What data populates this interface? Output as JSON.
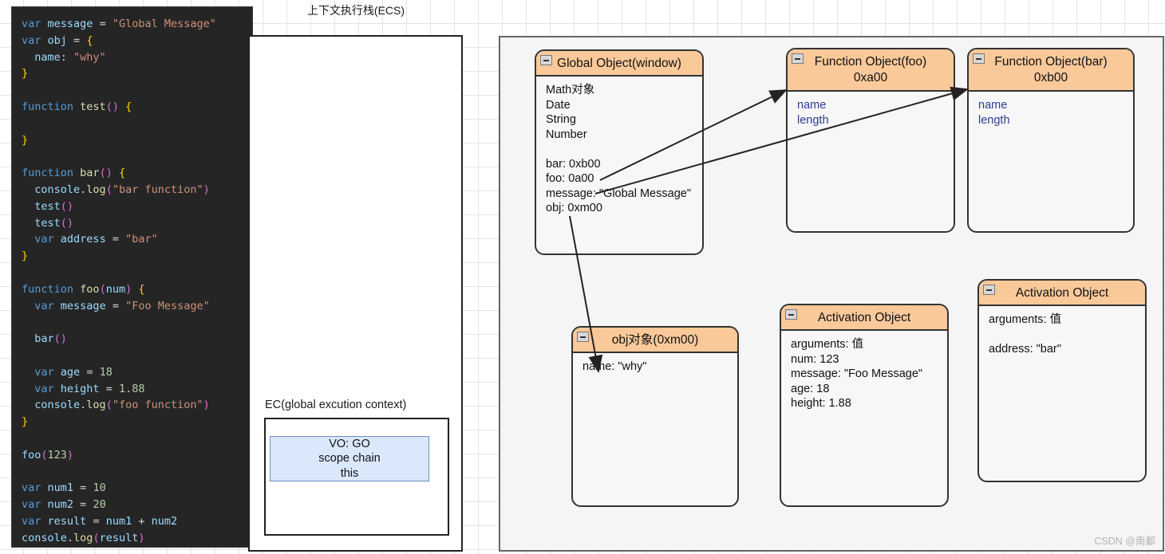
{
  "code_panel": {
    "language": "javascript",
    "lines": [
      [
        {
          "t": "var",
          "c": "kw"
        },
        {
          "t": " ",
          "c": "op"
        },
        {
          "t": "message",
          "c": "vr"
        },
        {
          "t": " = ",
          "c": "op"
        },
        {
          "t": "\"Global Message\"",
          "c": "st"
        }
      ],
      [
        {
          "t": "var",
          "c": "kw"
        },
        {
          "t": " ",
          "c": "op"
        },
        {
          "t": "obj",
          "c": "vr"
        },
        {
          "t": " = ",
          "c": "op"
        },
        {
          "t": "{",
          "c": "br"
        }
      ],
      [
        {
          "t": "  name",
          "c": "vr"
        },
        {
          "t": ": ",
          "c": "op"
        },
        {
          "t": "\"why\"",
          "c": "st"
        }
      ],
      [
        {
          "t": "}",
          "c": "br"
        }
      ],
      [],
      [
        {
          "t": "function",
          "c": "kw"
        },
        {
          "t": " ",
          "c": "op"
        },
        {
          "t": "test",
          "c": "fn"
        },
        {
          "t": "()",
          "c": "pp"
        },
        {
          "t": " ",
          "c": "op"
        },
        {
          "t": "{",
          "c": "br"
        }
      ],
      [],
      [
        {
          "t": "}",
          "c": "br"
        }
      ],
      [],
      [
        {
          "t": "function",
          "c": "kw"
        },
        {
          "t": " ",
          "c": "op"
        },
        {
          "t": "bar",
          "c": "fn"
        },
        {
          "t": "()",
          "c": "pp"
        },
        {
          "t": " ",
          "c": "op"
        },
        {
          "t": "{",
          "c": "br"
        }
      ],
      [
        {
          "t": "  console",
          "c": "vr"
        },
        {
          "t": ".",
          "c": "op"
        },
        {
          "t": "log",
          "c": "fn"
        },
        {
          "t": "(",
          "c": "pp"
        },
        {
          "t": "\"bar function\"",
          "c": "st"
        },
        {
          "t": ")",
          "c": "pp"
        }
      ],
      [
        {
          "t": "  test",
          "c": "vr"
        },
        {
          "t": "()",
          "c": "pp"
        }
      ],
      [
        {
          "t": "  test",
          "c": "vr"
        },
        {
          "t": "()",
          "c": "pp"
        }
      ],
      [
        {
          "t": "  ",
          "c": "op"
        },
        {
          "t": "var",
          "c": "kw"
        },
        {
          "t": " ",
          "c": "op"
        },
        {
          "t": "address",
          "c": "vr"
        },
        {
          "t": " = ",
          "c": "op"
        },
        {
          "t": "\"bar\"",
          "c": "st"
        }
      ],
      [
        {
          "t": "}",
          "c": "br"
        }
      ],
      [],
      [
        {
          "t": "function",
          "c": "kw"
        },
        {
          "t": " ",
          "c": "op"
        },
        {
          "t": "foo",
          "c": "fn"
        },
        {
          "t": "(",
          "c": "pp"
        },
        {
          "t": "num",
          "c": "vr"
        },
        {
          "t": ")",
          "c": "pp"
        },
        {
          "t": " ",
          "c": "op"
        },
        {
          "t": "{",
          "c": "br"
        }
      ],
      [
        {
          "t": "  ",
          "c": "op"
        },
        {
          "t": "var",
          "c": "kw"
        },
        {
          "t": " ",
          "c": "op"
        },
        {
          "t": "message",
          "c": "vr"
        },
        {
          "t": " = ",
          "c": "op"
        },
        {
          "t": "\"Foo Message\"",
          "c": "st"
        }
      ],
      [],
      [
        {
          "t": "  bar",
          "c": "vr"
        },
        {
          "t": "()",
          "c": "pp"
        }
      ],
      [],
      [
        {
          "t": "  ",
          "c": "op"
        },
        {
          "t": "var",
          "c": "kw"
        },
        {
          "t": " ",
          "c": "op"
        },
        {
          "t": "age",
          "c": "vr"
        },
        {
          "t": " = ",
          "c": "op"
        },
        {
          "t": "18",
          "c": "nm"
        }
      ],
      [
        {
          "t": "  ",
          "c": "op"
        },
        {
          "t": "var",
          "c": "kw"
        },
        {
          "t": " ",
          "c": "op"
        },
        {
          "t": "height",
          "c": "vr"
        },
        {
          "t": " = ",
          "c": "op"
        },
        {
          "t": "1.88",
          "c": "nm"
        }
      ],
      [
        {
          "t": "  console",
          "c": "vr"
        },
        {
          "t": ".",
          "c": "op"
        },
        {
          "t": "log",
          "c": "fn"
        },
        {
          "t": "(",
          "c": "pp"
        },
        {
          "t": "\"foo function\"",
          "c": "st"
        },
        {
          "t": ")",
          "c": "pp"
        }
      ],
      [
        {
          "t": "}",
          "c": "br"
        }
      ],
      [],
      [
        {
          "t": "foo",
          "c": "vr"
        },
        {
          "t": "(",
          "c": "pp"
        },
        {
          "t": "123",
          "c": "nm"
        },
        {
          "t": ")",
          "c": "pp"
        }
      ],
      [],
      [
        {
          "t": "var",
          "c": "kw"
        },
        {
          "t": " ",
          "c": "op"
        },
        {
          "t": "num1",
          "c": "vr"
        },
        {
          "t": " = ",
          "c": "op"
        },
        {
          "t": "10",
          "c": "nm"
        }
      ],
      [
        {
          "t": "var",
          "c": "kw"
        },
        {
          "t": " ",
          "c": "op"
        },
        {
          "t": "num2",
          "c": "vr"
        },
        {
          "t": " = ",
          "c": "op"
        },
        {
          "t": "20",
          "c": "nm"
        }
      ],
      [
        {
          "t": "var",
          "c": "kw"
        },
        {
          "t": " ",
          "c": "op"
        },
        {
          "t": "result",
          "c": "vr"
        },
        {
          "t": " = ",
          "c": "op"
        },
        {
          "t": "num1",
          "c": "vr"
        },
        {
          "t": " + ",
          "c": "op"
        },
        {
          "t": "num2",
          "c": "vr"
        }
      ],
      [
        {
          "t": "console",
          "c": "vr"
        },
        {
          "t": ".",
          "c": "op"
        },
        {
          "t": "log",
          "c": "fn"
        },
        {
          "t": "(",
          "c": "pp"
        },
        {
          "t": "result",
          "c": "vr"
        },
        {
          "t": ")",
          "c": "pp"
        }
      ]
    ]
  },
  "ecs": {
    "title": "上下文执行栈(ECS)",
    "ec_label": "EC(global excution context)",
    "vo_lines": [
      "VO: GO",
      "scope chain",
      "this"
    ]
  },
  "memory": {
    "boxes": {
      "global_object": {
        "title": "Global Object(window)",
        "icon": "collapse-minus-icon",
        "rows": [
          {
            "text": "Math对象"
          },
          {
            "text": "Date"
          },
          {
            "text": "String"
          },
          {
            "text": "Number"
          },
          {
            "text": ""
          },
          {
            "text": "bar: 0xb00"
          },
          {
            "text": "foo: 0a00"
          },
          {
            "text": "message: \"Global Message\""
          },
          {
            "text": "obj: 0xm00"
          }
        ]
      },
      "function_object_foo": {
        "title_line1": "Function Object(foo)",
        "title_line2": "0xa00",
        "icon": "collapse-minus-icon",
        "rows": [
          {
            "text": "name"
          },
          {
            "text": "length"
          }
        ]
      },
      "function_object_bar": {
        "title_line1": "Function Object(bar)",
        "title_line2": "0xb00",
        "icon": "collapse-minus-icon",
        "rows": [
          {
            "text": "name"
          },
          {
            "text": "length"
          }
        ]
      },
      "obj_object": {
        "title": "obj对象(0xm00)",
        "icon": "collapse-minus-icon",
        "rows": [
          {
            "text": "name: \"why\""
          }
        ]
      },
      "activation_object_foo": {
        "title": "Activation Object",
        "icon": "collapse-minus-icon",
        "rows": [
          {
            "text": "arguments: 值"
          },
          {
            "text": "num: 123"
          },
          {
            "text": "message: \"Foo Message\""
          },
          {
            "text": "age: 18"
          },
          {
            "text": "height: 1.88"
          }
        ]
      },
      "activation_object_bar": {
        "title": "Activation Object",
        "icon": "collapse-minus-icon",
        "rows": [
          {
            "text": "arguments: 值"
          },
          {
            "text": ""
          },
          {
            "text": "address: \"bar\""
          }
        ]
      }
    }
  },
  "watermark": "CSDN @南鄱",
  "colors": {
    "header_fill": "#fac99a",
    "box_body": "#f7f7f7",
    "box_border": "#333333",
    "vo_fill": "#dae8fc",
    "vo_border": "#6c8ebf",
    "container_fill": "#f5f5f5",
    "code_bg": "#252526",
    "grid_line": "#e4e4e4"
  }
}
